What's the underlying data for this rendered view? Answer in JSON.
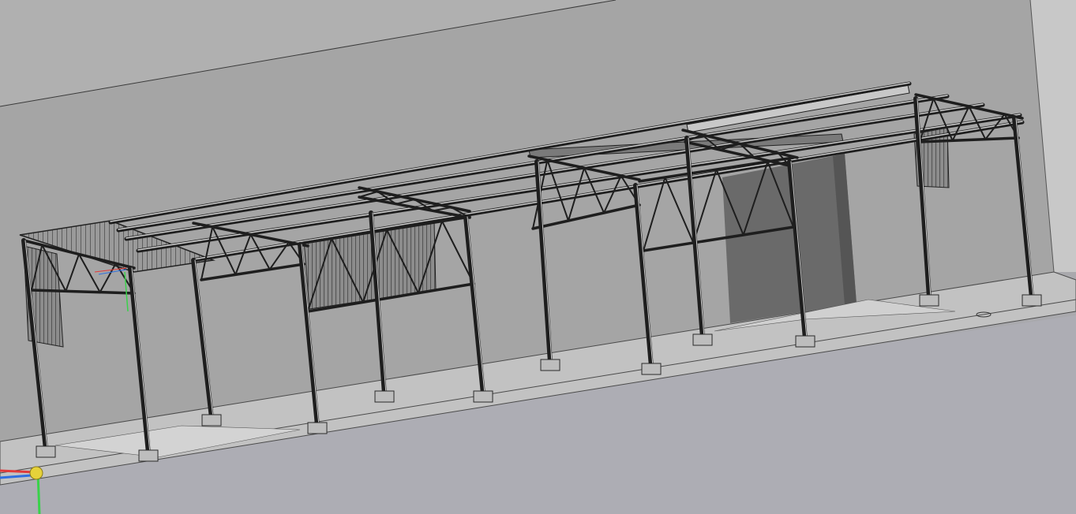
{
  "viewport": {
    "kind": "3d-cad-model-view",
    "colors": {
      "background": "#a9a9ad",
      "wall_face": "#a3a3a3",
      "wall_top_light": "#b2b2b2",
      "wall_right": "#c6c6c6",
      "ground": "#adadb4",
      "slab": "#c0c0c0",
      "steel": "#1e1e1e",
      "steel_light": "#cfcfcf",
      "door_recess": "#6e6e6e",
      "sheet": "#8f8f8f"
    }
  },
  "triad": {
    "x_color": "#e23a3a",
    "y_color": "#39d24a",
    "z_color": "#2f6fe0",
    "origin_color": "#e6d23a"
  }
}
